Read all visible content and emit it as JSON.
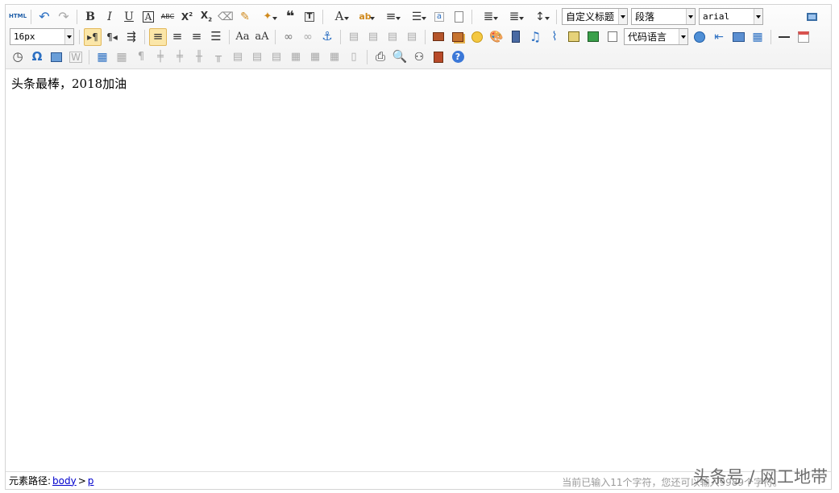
{
  "toolbar": {
    "row1": [
      {
        "name": "html-source-button",
        "icon": "html-icon",
        "glyph": "HTML"
      },
      {
        "name": "undo-button",
        "icon": "undo-icon",
        "glyph": "↶"
      },
      {
        "name": "redo-button",
        "icon": "redo-icon",
        "glyph": "↷"
      },
      {
        "name": "bold-button",
        "icon": "bold-icon",
        "glyph": "B"
      },
      {
        "name": "italic-button",
        "icon": "italic-icon",
        "glyph": "I"
      },
      {
        "name": "underline-button",
        "icon": "underline-icon",
        "glyph": "U"
      },
      {
        "name": "font-border-button",
        "icon": "font-border-icon",
        "glyph": "A"
      },
      {
        "name": "strikethrough-button",
        "icon": "strikethrough-icon",
        "glyph": "ABC"
      },
      {
        "name": "superscript-button",
        "icon": "superscript-icon",
        "glyph": "X²"
      },
      {
        "name": "subscript-button",
        "icon": "subscript-icon",
        "glyph": "X₂"
      },
      {
        "name": "clear-format-button",
        "icon": "eraser-icon",
        "glyph": "⌫"
      },
      {
        "name": "format-painter-button",
        "icon": "brush-icon",
        "glyph": "✎"
      },
      {
        "name": "auto-format-button",
        "icon": "magic-wand-icon",
        "glyph": "✦"
      },
      {
        "name": "blockquote-button",
        "icon": "quote-icon",
        "glyph": "❝"
      },
      {
        "name": "paste-plain-button",
        "icon": "paste-text-icon",
        "glyph": "T"
      },
      {
        "name": "font-color-button",
        "icon": "font-color-icon",
        "glyph": "A"
      },
      {
        "name": "highlight-button",
        "icon": "highlight-icon",
        "glyph": "ab"
      },
      {
        "name": "ordered-list-button",
        "icon": "ordered-list-icon",
        "glyph": "≡"
      },
      {
        "name": "unordered-list-button",
        "icon": "unordered-list-icon",
        "glyph": "☰"
      },
      {
        "name": "select-all-button",
        "icon": "select-all-icon",
        "glyph": "a"
      },
      {
        "name": "clear-doc-button",
        "icon": "clear-doc-icon",
        "glyph": "▭"
      },
      {
        "name": "row-spacing-top-button",
        "icon": "row-spacing-top-icon",
        "glyph": "≣"
      },
      {
        "name": "row-spacing-bottom-button",
        "icon": "row-spacing-bottom-icon",
        "glyph": "≣"
      },
      {
        "name": "line-height-button",
        "icon": "line-height-icon",
        "glyph": "↕"
      }
    ],
    "custom_style": "自定义标题",
    "paragraph": "段落",
    "font_family": "arial",
    "font_size": "16px",
    "code_language": "代码语言",
    "fullscreen_icon": "monitor-icon"
  },
  "content": {
    "text": "头条最棒，2018加油"
  },
  "status": {
    "path_label": "元素路径:",
    "path_body": "body",
    "path_sep": ">",
    "path_p": "p",
    "counter": "当前已输入11个字符，您还可以输入9989个字符。"
  },
  "watermark": "头条号 / 网工地带"
}
